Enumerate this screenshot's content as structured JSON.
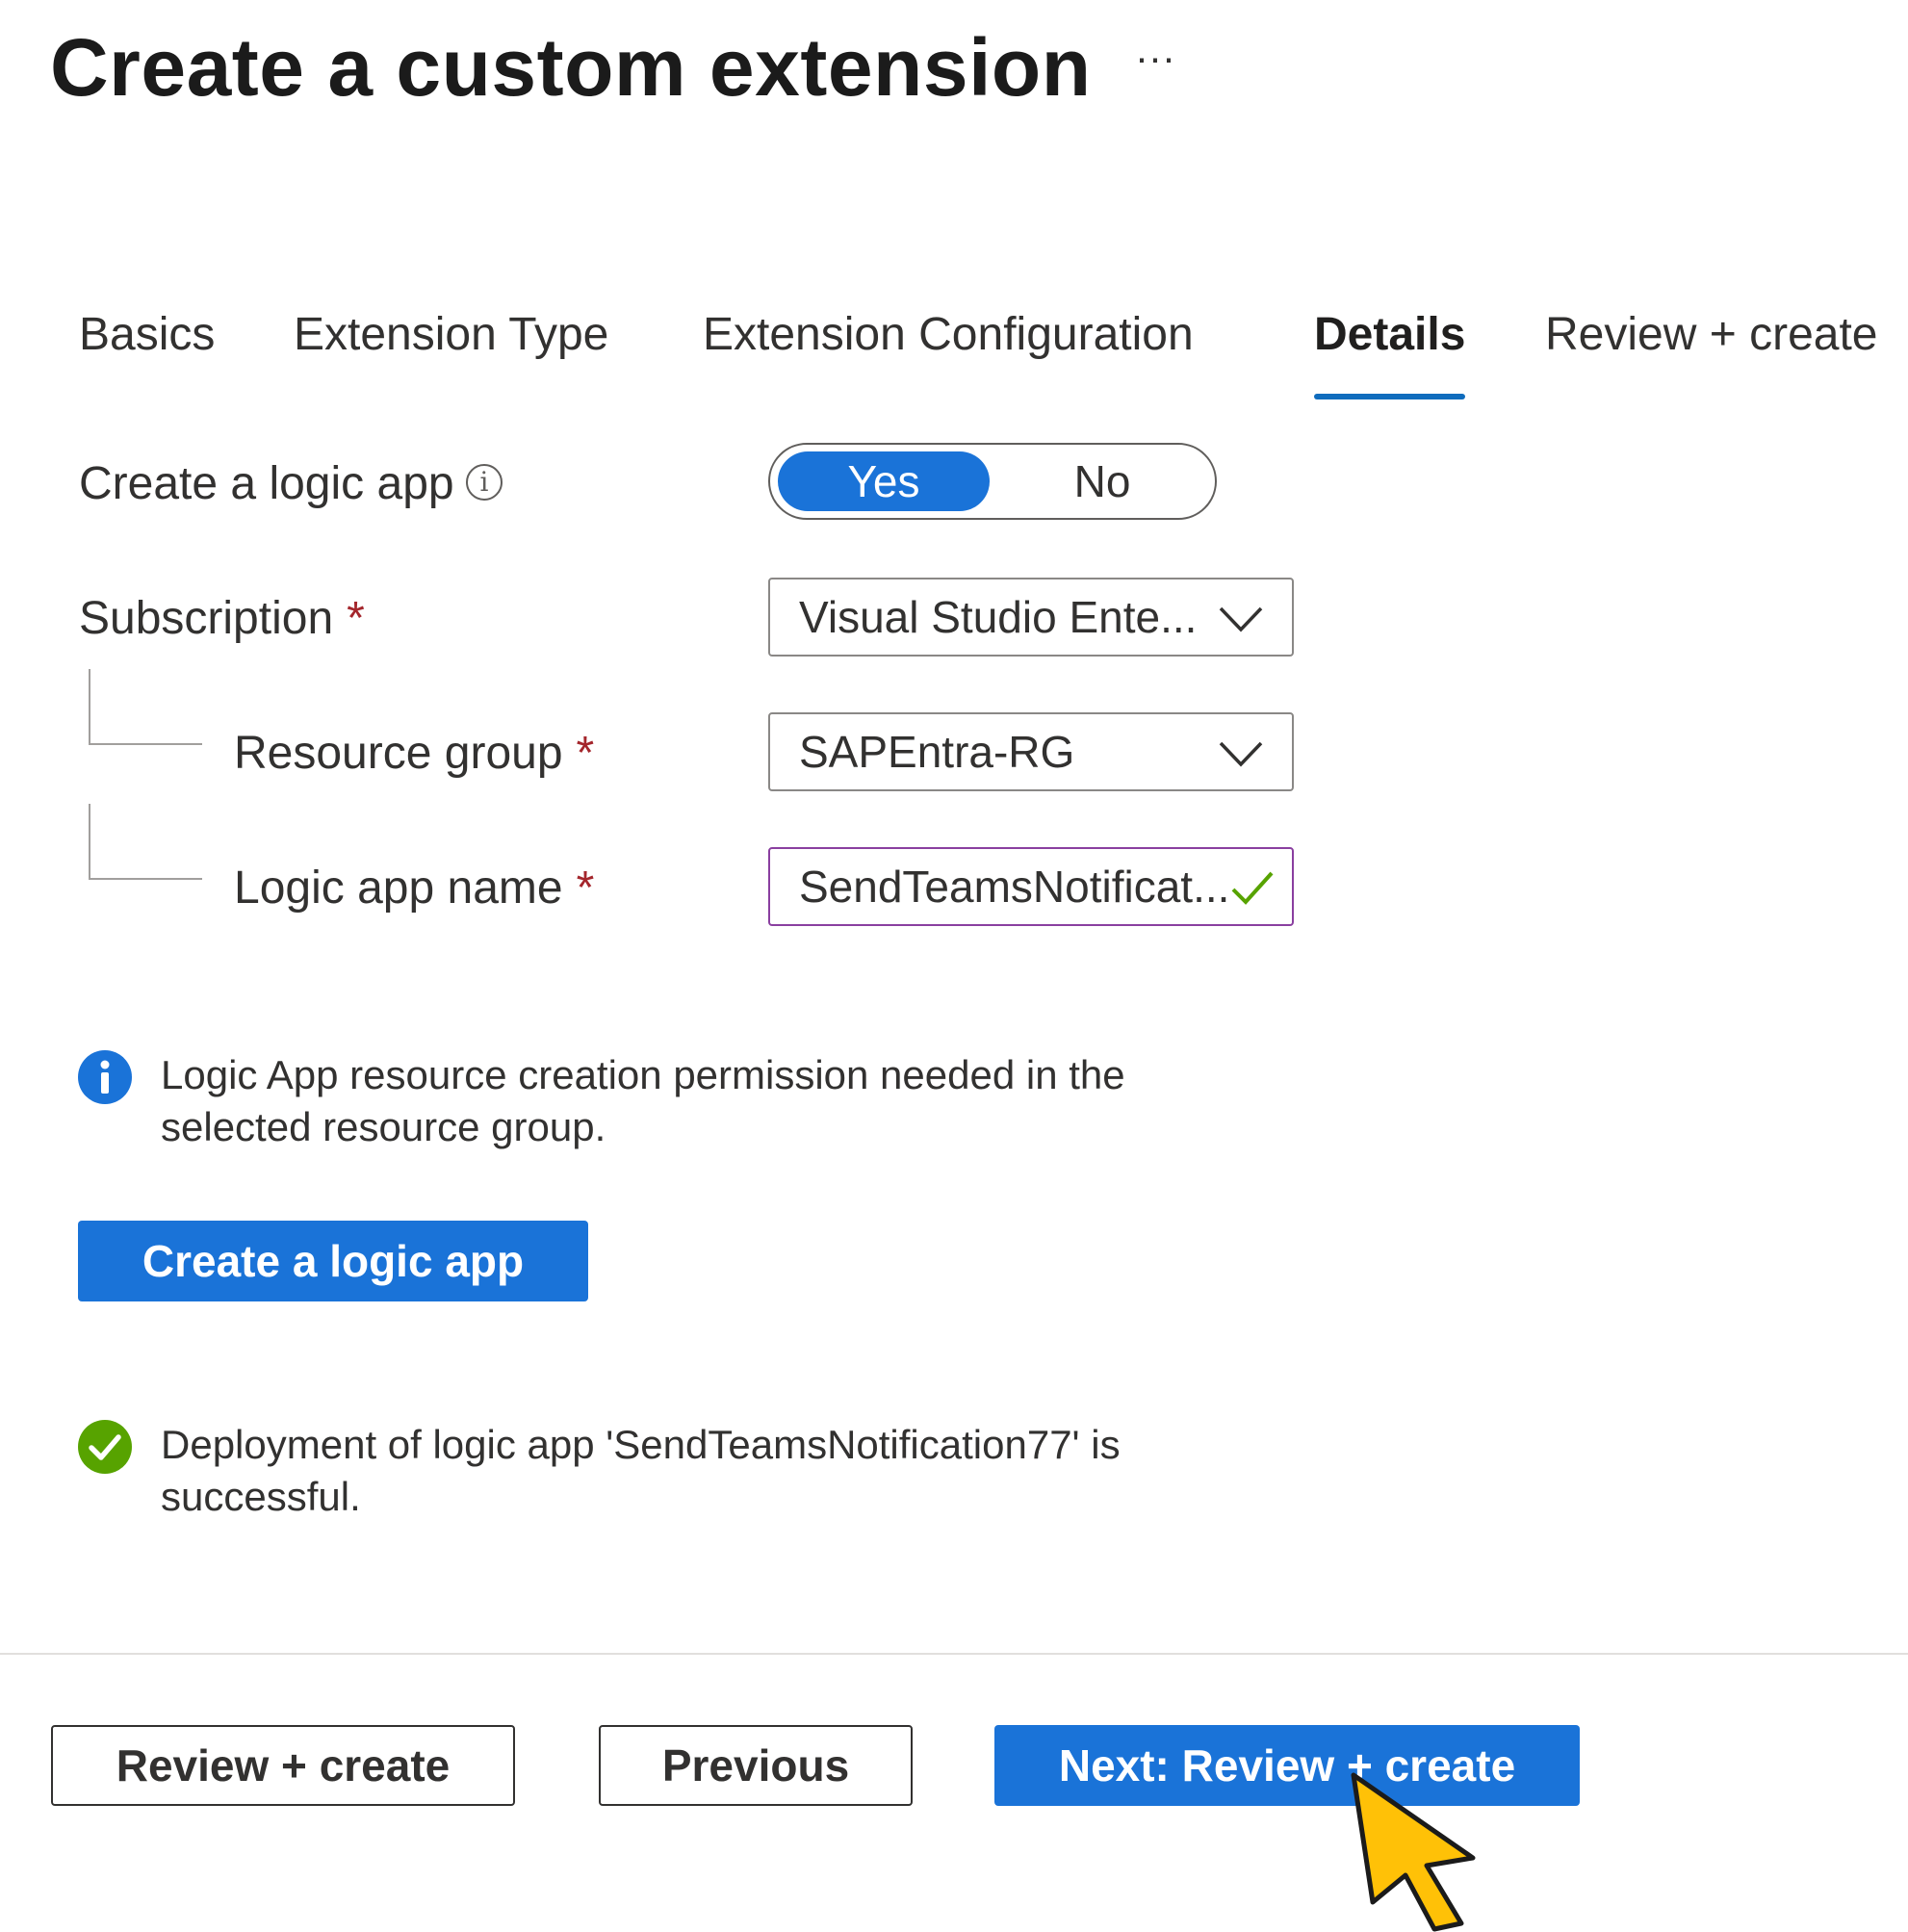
{
  "page": {
    "title": "Create a custom extension",
    "more_label": "···"
  },
  "tabs": [
    {
      "label": "Basics"
    },
    {
      "label": "Extension Type"
    },
    {
      "label": "Extension Configuration"
    },
    {
      "label": "Details",
      "active": true
    },
    {
      "label": "Review + create"
    }
  ],
  "form": {
    "create_logic_app_label": "Create a logic app",
    "toggle": {
      "yes": "Yes",
      "no": "No",
      "selected": "Yes"
    },
    "subscription_label": "Subscription",
    "subscription_value": "Visual Studio Ente...",
    "resource_group_label": "Resource group",
    "resource_group_value": "SAPEntra-RG",
    "logic_app_name_label": "Logic app name",
    "logic_app_name_value": "SendTeamsNotificat...",
    "required_marker": "*"
  },
  "info_message": {
    "line1": "Logic App resource creation permission needed in the",
    "line2": "selected resource group."
  },
  "create_logic_app_button": "Create a logic app",
  "success_message": {
    "line1": "Deployment of  logic app 'SendTeamsNotification77' is",
    "line2": "successful."
  },
  "footer": {
    "review_create": "Review + create",
    "previous": "Previous",
    "next": "Next: Review + create"
  },
  "colors": {
    "accent": "#1a73d8",
    "required": "#a4262c",
    "success": "#57a300",
    "valid_border": "#8a3fa0"
  },
  "icons": [
    "more-options-icon",
    "info-outline-icon",
    "chevron-down-icon",
    "checkmark-icon",
    "info-filled-icon",
    "success-check-icon",
    "mouse-cursor-icon"
  ]
}
